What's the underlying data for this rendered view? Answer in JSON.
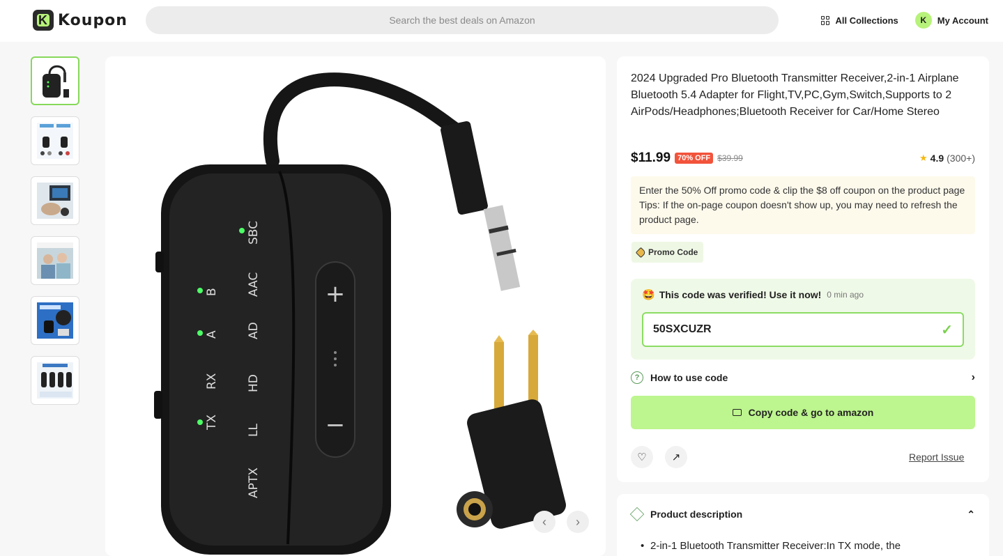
{
  "header": {
    "logo_letter": "K",
    "logo_text": "Koupon",
    "search_placeholder": "Search the best deals on Amazon",
    "collections_label": "All Collections",
    "avatar_initial": "K",
    "account_label": "My Account"
  },
  "gallery": {
    "thumbnail_count": 6,
    "active_index": 0
  },
  "product": {
    "title": "2024 Upgraded Pro Bluetooth Transmitter Receiver,2-in-1 Airplane Bluetooth 5.4 Adapter for Flight,TV,PC,Gym,Switch,Supports to 2 AirPods/Headphones;Bluetooth Receiver for Car/Home Stereo",
    "price": "$11.99",
    "discount_badge": "70% OFF",
    "original_price": "$39.99",
    "rating": "4.9",
    "rating_count": "(300+)",
    "note": "Enter the 50% Off promo code & clip the $8 off coupon on the product page Tips: If the on-page coupon doesn't show up, you may need to refresh the product page.",
    "promo_tag": "Promo Code",
    "verified_text": "This code was verified! Use it now!",
    "verified_ago": "0 min ago",
    "code": "50SXCUZR",
    "how_to_label": "How to use code",
    "copy_button": "Copy code & go to amazon",
    "report_label": "Report Issue"
  },
  "description": {
    "heading": "Product description",
    "first_bullet": "2-in-1 Bluetooth Transmitter Receiver:In TX mode, the"
  },
  "device_labels": {
    "left_column": [
      "B",
      "A",
      "RX",
      "TX"
    ],
    "right_column": [
      "SBC",
      "AAC",
      "AD",
      "HD",
      "LL",
      "APTX"
    ]
  },
  "colors": {
    "accent_green": "#bdf58e",
    "badge_red": "#f2533b",
    "star": "#f5b914"
  }
}
